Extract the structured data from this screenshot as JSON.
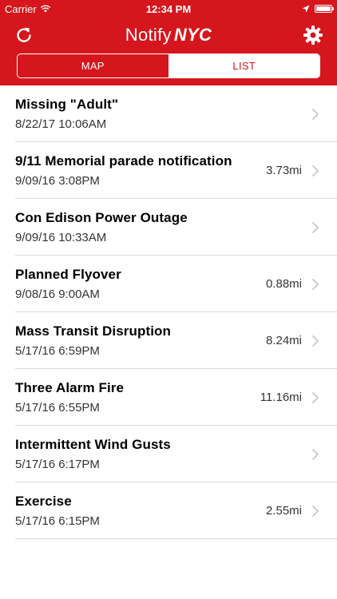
{
  "status_bar": {
    "carrier": "Carrier",
    "time": "12:34 PM"
  },
  "header": {
    "title_part1": "Notify",
    "title_part2": "NYC",
    "refresh_icon": "refresh-icon",
    "settings_icon": "gear-icon",
    "brand_color": "#d5161c"
  },
  "tabs": {
    "map_label": "MAP",
    "list_label": "LIST",
    "selected": "LIST"
  },
  "notifications": [
    {
      "title": "Missing \"Adult\"",
      "time": "8/22/17 10:06AM",
      "distance": ""
    },
    {
      "title": "9/11 Memorial parade notification",
      "time": "9/09/16 3:08PM",
      "distance": "3.73mi"
    },
    {
      "title": "Con Edison Power Outage",
      "time": "9/09/16 10:33AM",
      "distance": ""
    },
    {
      "title": "Planned Flyover",
      "time": "9/08/16 9:00AM",
      "distance": "0.88mi"
    },
    {
      "title": "Mass Transit Disruption",
      "time": "5/17/16 6:59PM",
      "distance": "8.24mi"
    },
    {
      "title": "Three Alarm Fire",
      "time": "5/17/16 6:55PM",
      "distance": "11.16mi"
    },
    {
      "title": "Intermittent Wind Gusts",
      "time": "5/17/16 6:17PM",
      "distance": ""
    },
    {
      "title": "Exercise",
      "time": "5/17/16 6:15PM",
      "distance": "2.55mi"
    }
  ]
}
